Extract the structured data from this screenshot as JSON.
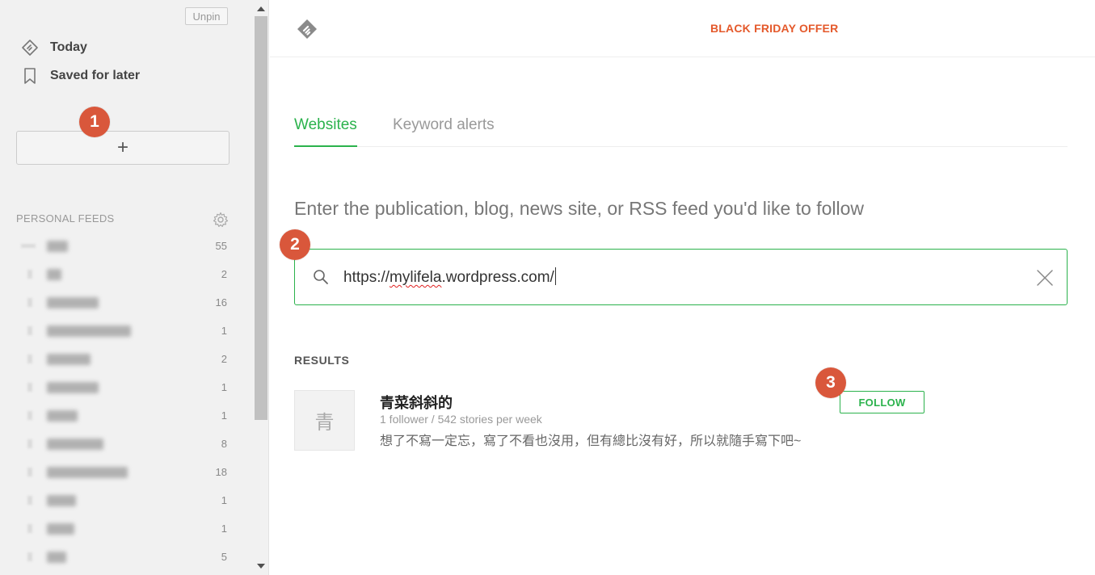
{
  "sidebar": {
    "unpin_label": "Unpin",
    "nav": {
      "today": "Today",
      "saved": "Saved for later"
    },
    "add_label": "+",
    "feeds_header": "PERSONAL FEEDS",
    "feeds": [
      {
        "count": "55"
      },
      {
        "count": "2"
      },
      {
        "count": "16"
      },
      {
        "count": "1"
      },
      {
        "count": "2"
      },
      {
        "count": "1"
      },
      {
        "count": "1"
      },
      {
        "count": "8"
      },
      {
        "count": "18"
      },
      {
        "count": "1"
      },
      {
        "count": "1"
      },
      {
        "count": "5"
      }
    ]
  },
  "markers": {
    "one": "1",
    "two": "2",
    "three": "3"
  },
  "topbar": {
    "offer": "BLACK FRIDAY OFFER"
  },
  "tabs": {
    "websites": "Websites",
    "keywords": "Keyword alerts"
  },
  "prompt": "Enter the publication, blog, news site, or RSS feed you'd like to follow",
  "search": {
    "prefix": "https://",
    "misspelled": "mylifela",
    "suffix": ".wordpress.com/"
  },
  "results": {
    "label": "RESULTS",
    "items": [
      {
        "thumb_char": "青",
        "title": "青菜斜斜的",
        "meta": "1 follower / 542 stories per week",
        "description": "想了不寫一定忘，寫了不看也沒用，但有總比沒有好，所以就隨手寫下吧~",
        "follow_label": "FOLLOW"
      }
    ]
  },
  "colors": {
    "accent_green": "#2bb24c",
    "offer_orange": "#e4592b",
    "marker_red": "#d9573b"
  }
}
